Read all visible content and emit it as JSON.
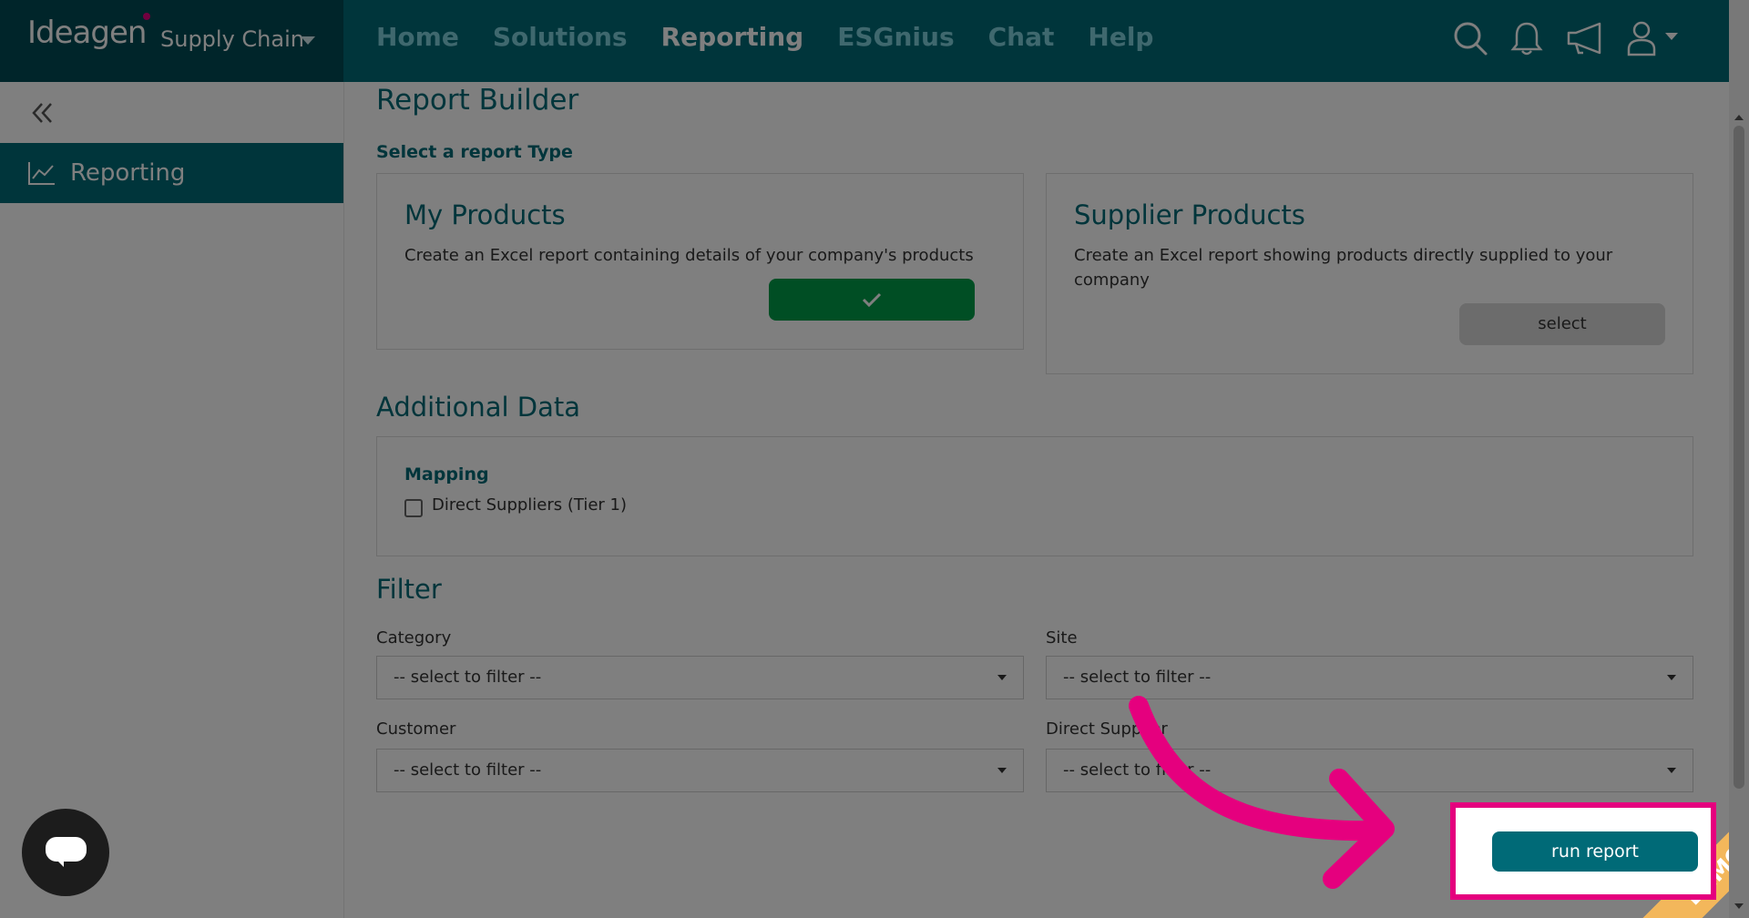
{
  "brand": {
    "name": "Ideagen",
    "product": "Supply Chain"
  },
  "nav": {
    "items": [
      "Home",
      "Solutions",
      "Reporting",
      "ESGnius",
      "Chat",
      "Help"
    ],
    "active": "Reporting"
  },
  "sidebar": {
    "items": [
      {
        "label": "Reporting",
        "icon": "chart-line-icon"
      }
    ]
  },
  "page": {
    "title": "Report Builder",
    "select_type_label": "Select a report Type"
  },
  "report_types": [
    {
      "title": "My Products",
      "description": "Create an Excel report containing details of your company's products",
      "state": "selected"
    },
    {
      "title": "Supplier Products",
      "description": "Create an Excel report showing products directly supplied to your company",
      "button_label": "select"
    }
  ],
  "additional_data": {
    "title": "Additional Data",
    "group_title": "Mapping",
    "checkbox_label": "Direct Suppliers (Tier 1)",
    "checked": false
  },
  "filter": {
    "title": "Filter",
    "fields": [
      {
        "label": "Category",
        "value": "-- select to filter --"
      },
      {
        "label": "Site",
        "value": "-- select to filter --"
      },
      {
        "label": "Customer",
        "value": "-- select to filter --"
      },
      {
        "label": "Direct Supplier",
        "value": "-- select to filter --"
      }
    ]
  },
  "actions": {
    "run_report": "run report"
  },
  "ribbon": {
    "text": "DEMO"
  },
  "colors": {
    "primary": "#006a77",
    "brand_dark": "#004b55",
    "success": "#009d48",
    "highlight": "#e5007e",
    "ribbon": "#f3b75b"
  }
}
